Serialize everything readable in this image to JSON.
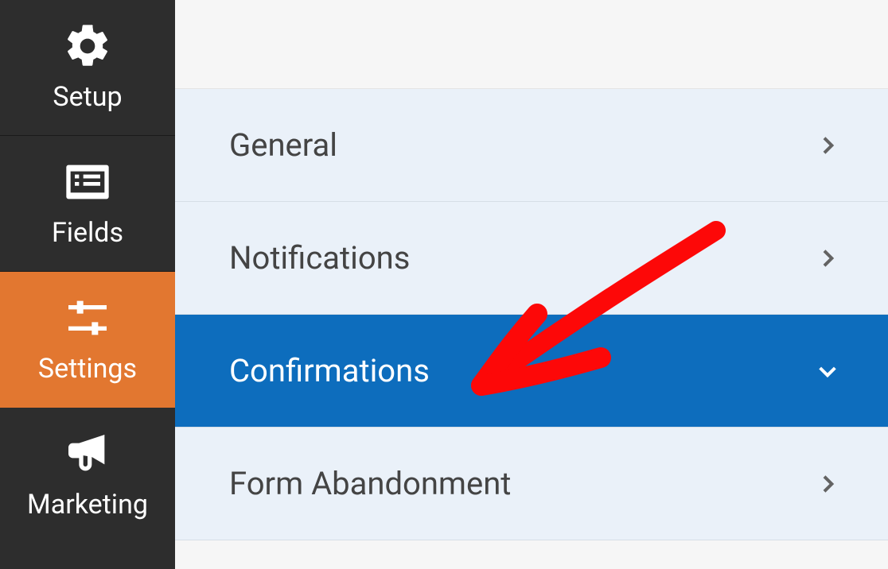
{
  "sidebar": {
    "items": [
      {
        "label": "Setup",
        "icon": "gear-icon",
        "active": false
      },
      {
        "label": "Fields",
        "icon": "list-icon",
        "active": false
      },
      {
        "label": "Settings",
        "icon": "sliders-icon",
        "active": true
      },
      {
        "label": "Marketing",
        "icon": "bullhorn-icon",
        "active": false
      }
    ]
  },
  "settings": {
    "rows": [
      {
        "label": "General",
        "active": false,
        "expanded": false
      },
      {
        "label": "Notifications",
        "active": false,
        "expanded": false
      },
      {
        "label": "Confirmations",
        "active": true,
        "expanded": true
      },
      {
        "label": "Form Abandonment",
        "active": false,
        "expanded": false
      }
    ]
  },
  "annotation": {
    "kind": "red-arrow",
    "points_to": "Confirmations"
  }
}
